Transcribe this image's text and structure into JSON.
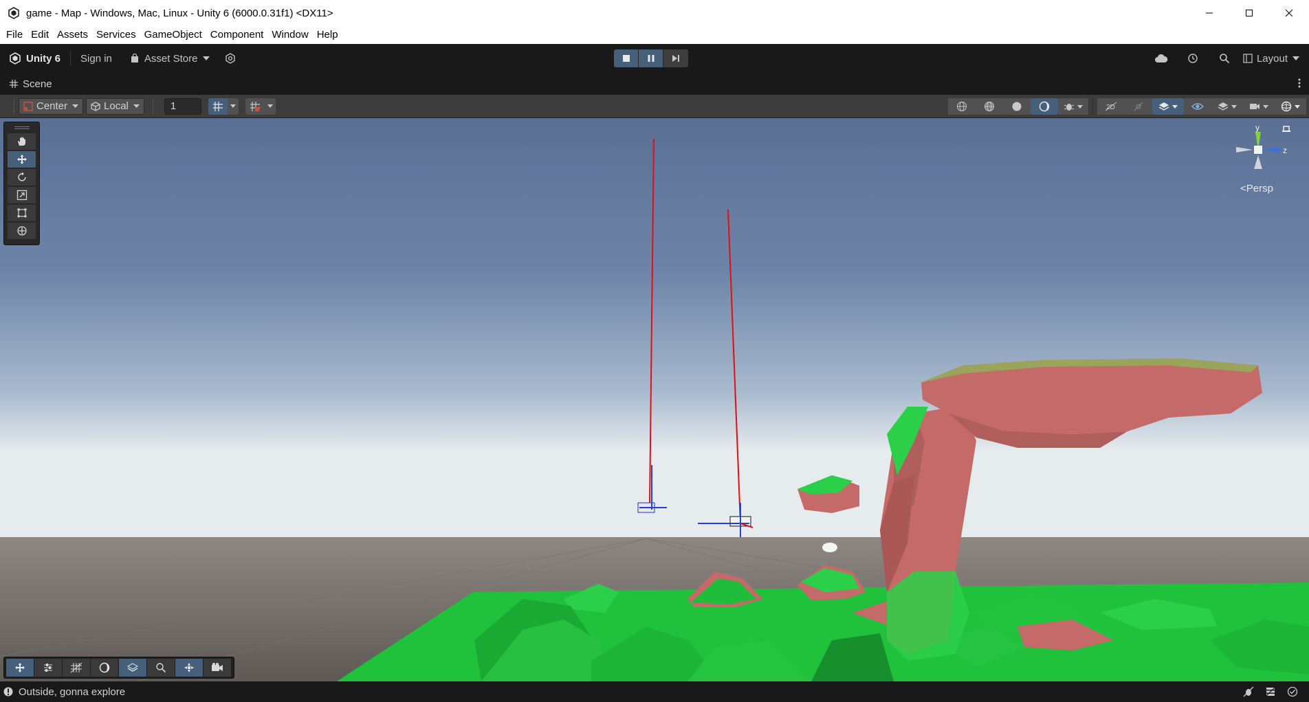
{
  "window": {
    "title": "game - Map - Windows, Mac, Linux - Unity 6 (6000.0.31f1) <DX11>",
    "app_icon": "unity-logo-icon",
    "controls": [
      "minimize-icon",
      "maximize-icon",
      "close-icon"
    ]
  },
  "menu": {
    "items": [
      "File",
      "Edit",
      "Assets",
      "Services",
      "GameObject",
      "Component",
      "Window",
      "Help"
    ]
  },
  "toolbar": {
    "account_label": "Unity 6",
    "signin_label": "Sign in",
    "asset_store_label": "Asset Store",
    "play_state": "playing",
    "layout_label": "Layout"
  },
  "scene_tab": {
    "label": "Scene"
  },
  "scene_toolbar": {
    "pivot_mode": "Center",
    "pivot_rotation": "Local",
    "grid_snap_value": "1"
  },
  "viewport": {
    "camera_mode": "Persp",
    "gizmo_axes": {
      "y": "y",
      "z": "z"
    },
    "colors": {
      "sky_top": "#5a6f96",
      "sky_horizon": "#e6ebee",
      "ground": "#625c58",
      "terrain_green": "#1fbd3a",
      "terrain_pink": "#c46a68",
      "ray_red": "#e01010"
    }
  },
  "tools": [
    "hand-tool",
    "move-tool",
    "rotate-tool",
    "scale-tool",
    "rect-tool",
    "transform-tool"
  ],
  "overlay_tools": [
    "move",
    "tool-settings",
    "grid",
    "shading",
    "layers",
    "search",
    "orientation",
    "camera"
  ],
  "status": {
    "message": "Outside, gonna explore"
  }
}
